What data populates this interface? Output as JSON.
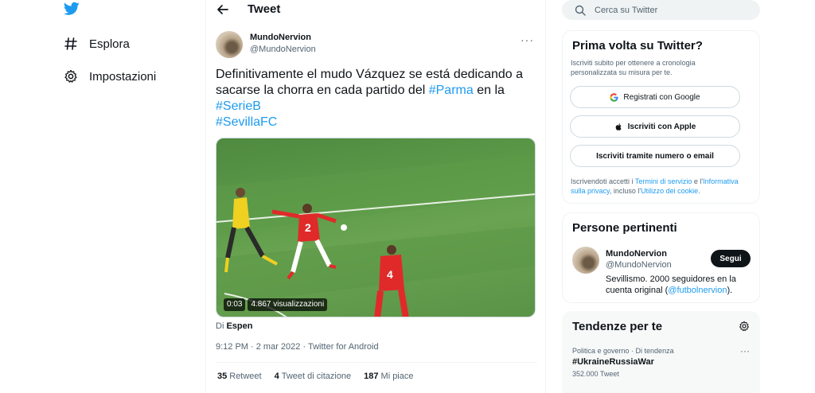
{
  "nav": {
    "items": [
      {
        "label": "Esplora"
      },
      {
        "label": "Impostazioni"
      }
    ]
  },
  "header": {
    "title": "Tweet"
  },
  "tweet": {
    "author_name": "MundoNervion",
    "author_handle": "@MundoNervion",
    "more": "···",
    "text_part1": "Definitivamente el mudo Vázquez se está dedicando a sacarse la chorra en cada partido del ",
    "hashtag_parma": "#Parma",
    "text_part2": " en la ",
    "hashtag_serieb": "#SerieB",
    "hashtag_sevilla": "#SevillaFC",
    "video_time": "0:03",
    "video_views": "4.867 visualizzazioni",
    "source_prefix": "Di",
    "source_name": "Espen",
    "timestamp": "9:12 PM · 2 mar 2022 · Twitter for Android",
    "retweets_count": "35",
    "retweets_label": "Retweet",
    "quotes_count": "4",
    "quotes_label": "Tweet di citazione",
    "likes_count": "187",
    "likes_label": "Mi piace"
  },
  "sidebar": {
    "search_placeholder": "Cerca su Twitter",
    "signup": {
      "title": "Prima volta su Twitter?",
      "subtitle": "Iscriviti subito per ottenere a cronologia personalizzata su misura per te.",
      "google_button": "Registrati con Google",
      "apple_button": "Iscriviti con Apple",
      "phone_button": "Iscriviti tramite numero o email",
      "terms_1": "Iscrivendoti accetti i ",
      "terms_link": "Termini di servizio",
      "terms_2": " e l'",
      "privacy_link": "Informativa sulla privacy",
      "terms_3": ", incluso l'",
      "cookie_link": "Utilizzo dei cookie",
      "terms_4": "."
    },
    "people": {
      "title": "Persone pertinenti",
      "name": "MundoNervion",
      "handle": "@MundoNervion",
      "follow_label": "Segui",
      "bio_1": "Sevillismo. 2000 seguidores en la cuenta original (",
      "bio_link": "@futbolnervion",
      "bio_2": ")."
    },
    "trends": {
      "title": "Tendenze per te",
      "category": "Politica e governo · Di tendenza",
      "name": "#UkraineRussiaWar",
      "count": "352.000 Tweet",
      "more": "···"
    }
  },
  "colors": {
    "accent": "#1d9bf0",
    "text": "#0f1419",
    "muted": "#536471"
  }
}
